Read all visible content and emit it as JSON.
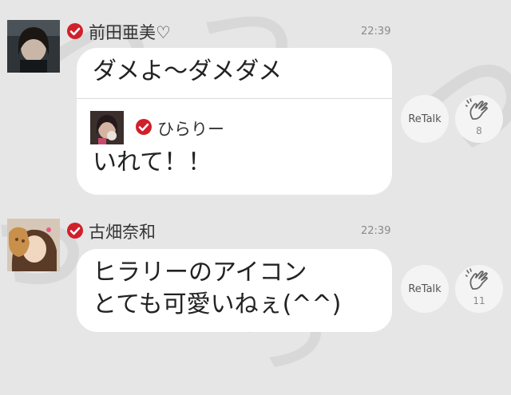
{
  "colors": {
    "background": "#e6e6e6",
    "bubble": "#ffffff",
    "verified": "#d0202b"
  },
  "messages": [
    {
      "name": "前田亜美♡",
      "time": "22:39",
      "text": "ダメよ〜ダメダメ",
      "quote": {
        "name": "ひらりー",
        "text": "いれて！！"
      },
      "retalk_label": "ReTalk",
      "clap_count": "8"
    },
    {
      "name": "古畑奈和",
      "time": "22:39",
      "lines": [
        "ヒラリーのアイコン",
        "とても可愛いねぇ(^^)"
      ],
      "retalk_label": "ReTalk",
      "clap_count": "11"
    }
  ]
}
